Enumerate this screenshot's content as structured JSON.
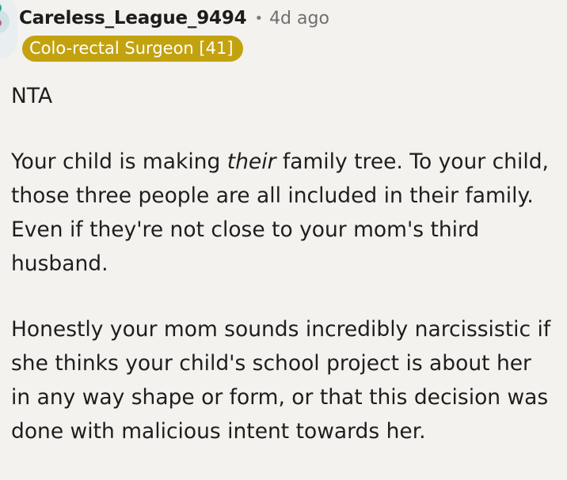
{
  "comment": {
    "username": "Careless_League_9494",
    "separator": "•",
    "time_ago": "4d ago",
    "flair": "Colo-rectal Surgeon [41]",
    "paragraph1": [
      "NTA"
    ],
    "paragraph2": {
      "line1_before": "Your child is making ",
      "line1_emph": "their",
      "line1_after": " family tree. To your child,",
      "line2": "those three people are all included in their family.",
      "line3": "Even if they're not close to your mom's third",
      "line4": "husband."
    },
    "paragraph3": [
      "Honestly your mom sounds incredibly narcissistic if",
      "she thinks your child's school project is about her",
      "in any way shape or form, or that this decision was",
      "done with malicious intent towards her."
    ]
  },
  "colors": {
    "background": "#f4f2ef",
    "flair_background": "#c3a20f",
    "flair_text": "#ffffff",
    "meta_text": "#6f6f6f"
  },
  "icons": {
    "avatar": "user-avatar"
  }
}
